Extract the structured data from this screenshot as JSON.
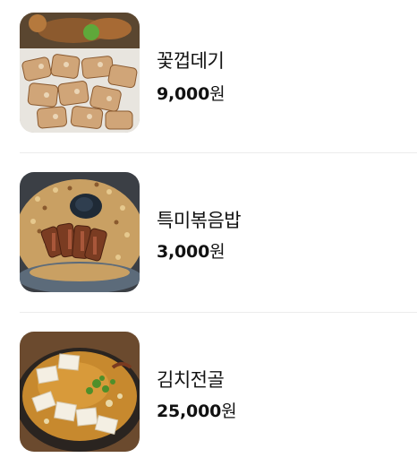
{
  "menu": {
    "items": [
      {
        "name": "꽃껍데기",
        "amount": "9,000",
        "unit": "원",
        "image_icon": "grilled-pork-skin-photo"
      },
      {
        "name": "특미볶음밥",
        "amount": "3,000",
        "unit": "원",
        "image_icon": "fried-rice-photo"
      },
      {
        "name": "김치전골",
        "amount": "25,000",
        "unit": "원",
        "image_icon": "kimchi-stew-photo"
      }
    ]
  },
  "colors": {
    "text": "#111111",
    "divider": "#ececec"
  }
}
